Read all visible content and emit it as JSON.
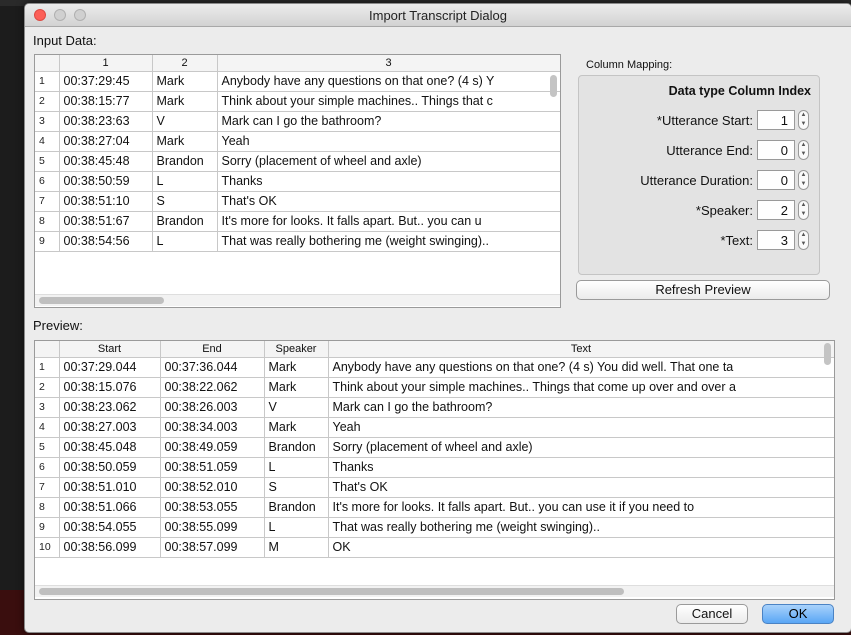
{
  "window": {
    "title": "Import Transcript Dialog"
  },
  "input": {
    "label": "Input Data:",
    "columns": [
      "1",
      "2",
      "3"
    ],
    "rows": [
      [
        "1",
        "00:37:29:45",
        "Mark",
        "Anybody have any questions on that one?  (4 s) Y"
      ],
      [
        "2",
        "00:38:15:77",
        "Mark",
        "Think about your simple machines.. Things that c"
      ],
      [
        "3",
        "00:38:23:63",
        "V",
        "Mark can I go the bathroom?"
      ],
      [
        "4",
        "00:38:27:04",
        "Mark",
        "Yeah"
      ],
      [
        "5",
        "00:38:45:48",
        "Brandon",
        "Sorry (placement of wheel and axle)"
      ],
      [
        "6",
        "00:38:50:59",
        "L",
        "Thanks"
      ],
      [
        "7",
        "00:38:51:10",
        "S",
        "That's OK"
      ],
      [
        "8",
        "00:38:51:67",
        "Brandon",
        "It's more for looks. It falls apart.  But.. you can u"
      ],
      [
        "9",
        "00:38:54:56",
        "L",
        "That was really bothering me (weight swinging).."
      ]
    ]
  },
  "mapping": {
    "label": "Column Mapping:",
    "header": "Data type Column Index",
    "fields": [
      {
        "label": "*Utterance Start:",
        "value": "1"
      },
      {
        "label": "Utterance End:",
        "value": "0"
      },
      {
        "label": "Utterance Duration:",
        "value": "0"
      },
      {
        "label": "*Speaker:",
        "value": "2"
      },
      {
        "label": "*Text:",
        "value": "3"
      }
    ],
    "refresh_label": "Refresh Preview"
  },
  "preview": {
    "label": "Preview:",
    "columns": [
      "Start",
      "End",
      "Speaker",
      "Text"
    ],
    "rows": [
      [
        "1",
        "00:37:29.044",
        "00:37:36.044",
        "Mark",
        "Anybody have any questions on that one?  (4 s) You did well.  That one ta"
      ],
      [
        "2",
        "00:38:15.076",
        "00:38:22.062",
        "Mark",
        "Think about your simple machines.. Things that come up over and over a"
      ],
      [
        "3",
        "00:38:23.062",
        "00:38:26.003",
        "V",
        "Mark can I go the bathroom?"
      ],
      [
        "4",
        "00:38:27.003",
        "00:38:34.003",
        "Mark",
        "Yeah"
      ],
      [
        "5",
        "00:38:45.048",
        "00:38:49.059",
        "Brandon",
        "Sorry (placement of wheel and axle)"
      ],
      [
        "6",
        "00:38:50.059",
        "00:38:51.059",
        "L",
        "Thanks"
      ],
      [
        "7",
        "00:38:51.010",
        "00:38:52.010",
        "S",
        "That's OK"
      ],
      [
        "8",
        "00:38:51.066",
        "00:38:53.055",
        "Brandon",
        "It's more for looks. It falls apart.  But.. you can use it if you need to"
      ],
      [
        "9",
        "00:38:54.055",
        "00:38:55.099",
        "L",
        "That was really bothering me (weight swinging).."
      ],
      [
        "10",
        "00:38:56.099",
        "00:38:57.099",
        "M",
        "OK"
      ]
    ]
  },
  "buttons": {
    "cancel": "Cancel",
    "ok": "OK"
  }
}
